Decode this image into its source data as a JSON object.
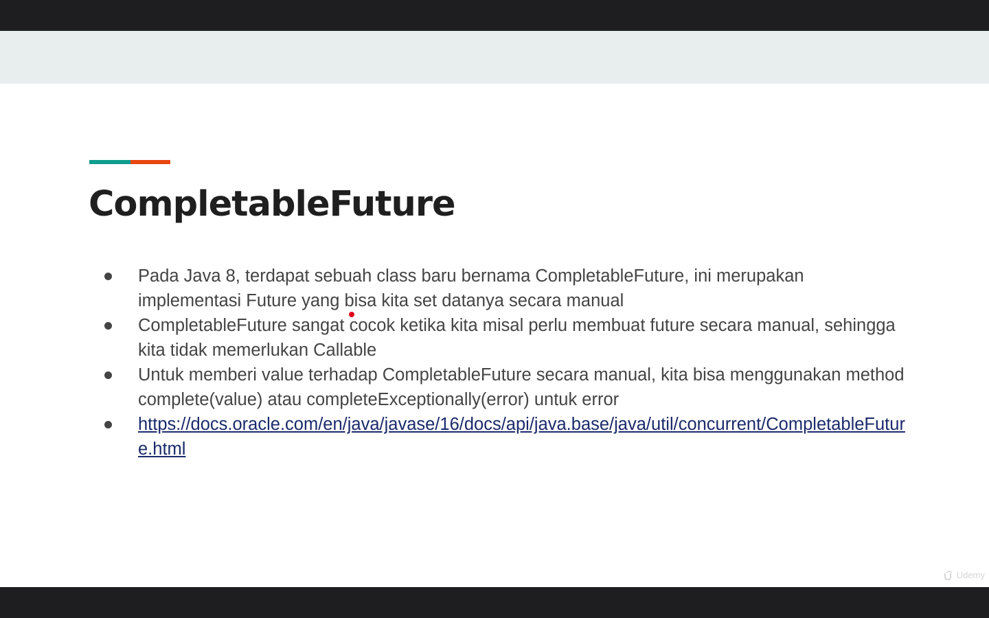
{
  "slide": {
    "title": "CompletableFuture",
    "accent_colors": [
      "#0f9d8f",
      "#e8470f"
    ],
    "bullets": [
      {
        "text": "Pada Java 8, terdapat sebuah class baru bernama CompletableFuture, ini merupakan implementasi Future yang bisa kita set datanya secara manual"
      },
      {
        "text": "CompletableFuture sangat cocok ketika kita misal perlu membuat future secara manual, sehingga kita tidak memerlukan Callable"
      },
      {
        "text": "Untuk memberi value terhadap CompletableFuture secara manual, kita bisa menggunakan method complete(value) atau completeExceptionally(error) untuk error"
      },
      {
        "link": "https://docs.oracle.com/en/java/javase/16/docs/api/java.base/java/util/concurrent/CompletableFuture.html"
      }
    ]
  },
  "watermark": {
    "label": "Udemy",
    "icon": "udemy-logo-icon"
  },
  "pointer": {
    "color": "#e3001b"
  }
}
